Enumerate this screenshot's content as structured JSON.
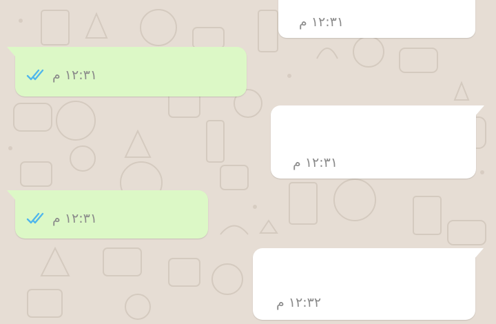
{
  "colors": {
    "wallpaper": "#e6ddd4",
    "incoming_bubble": "#ffffff",
    "outgoing_bubble": "#dcf8c6",
    "timestamp": "#8a8a8a",
    "read_ticks": "#4fb6ec"
  },
  "messages": [
    {
      "direction": "incoming",
      "time": "١٢:٣١ م",
      "text": ""
    },
    {
      "direction": "outgoing",
      "time": "١٢:٣١ م",
      "status": "read",
      "status_icon": "double-check-icon",
      "text": ""
    },
    {
      "direction": "incoming",
      "time": "١٢:٣١ م",
      "text": ""
    },
    {
      "direction": "outgoing",
      "time": "١٢:٣١ م",
      "status": "read",
      "status_icon": "double-check-icon",
      "text": ""
    },
    {
      "direction": "incoming",
      "time": "١٢:٣٢ م",
      "text": ""
    }
  ]
}
